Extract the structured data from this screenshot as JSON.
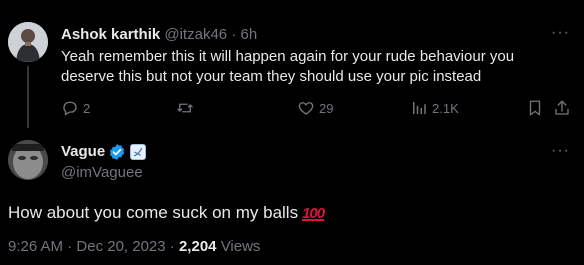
{
  "reply": {
    "author_name": "Ashok karthik",
    "handle": "@itzak46",
    "separator": "·",
    "time": "6h",
    "text": "Yeah remember this it will happen again for your rude behaviour you deserve this but not your team they should use your pic instead",
    "more_label": "···",
    "actions": {
      "replies": "2",
      "retweets": "",
      "likes": "29",
      "views": "2.1K"
    }
  },
  "main_tweet": {
    "author_name": "Vague",
    "handle": "@imVaguee",
    "more_label": "···",
    "text": "How about you come suck on my balls",
    "emoji": "100",
    "time": "9:26 AM",
    "separator": "·",
    "date": "Dec 20, 2023",
    "views_count": "2,204",
    "views_label": "Views"
  },
  "icons": [
    "reply-icon",
    "retweet-icon",
    "like-icon",
    "views-icon",
    "bookmark-icon",
    "share-icon",
    "verified-badge-icon",
    "affiliate-badge-icon"
  ],
  "colors": {
    "background": "#000000",
    "text": "#e7e9ea",
    "muted": "#71767b",
    "verified": "#1d9bf0",
    "emoji_red": "#d6163c"
  }
}
